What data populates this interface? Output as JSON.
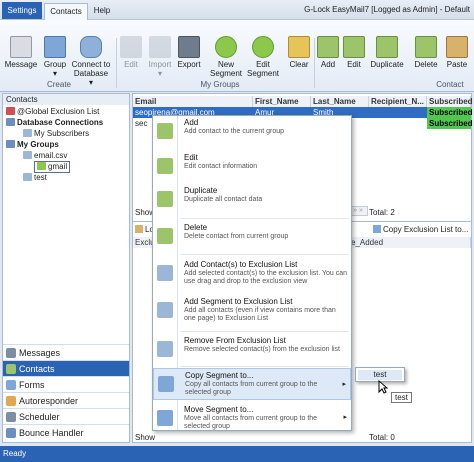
{
  "app": {
    "title": "G-Lock EasyMail7 [Logged as Admin] - Default"
  },
  "tabs": {
    "settings": "Settings",
    "contacts": "Contacts",
    "help": "Help"
  },
  "ribbon": {
    "message": "Message",
    "group": "Group",
    "connect1": "Connect to",
    "connect2": "Database",
    "edit": "Edit",
    "import": "Import",
    "export": "Export",
    "new_segment1": "New",
    "new_segment2": "Segment",
    "edit_segment1": "Edit",
    "edit_segment2": "Segment",
    "clear": "Clear",
    "add": "Add",
    "edit2": "Edit",
    "duplicate": "Duplicate",
    "delete": "Delete",
    "paste": "Paste",
    "group_create": "Create",
    "group_mygroups": "My Groups",
    "group_contact": "Contact"
  },
  "sidebar": {
    "header": "Contacts",
    "global_exclusion": "@Global Exclusion List",
    "db_connections": "Database Connections",
    "my_subscribers": "My Subscribers",
    "my_groups": "My Groups",
    "email_csv": "email.csv",
    "gmail": "gmail",
    "test": "test"
  },
  "nav": {
    "messages": "Messages",
    "contacts": "Contacts",
    "forms": "Forms",
    "autoresponder": "Autoresponder",
    "scheduler": "Scheduler",
    "bounce": "Bounce Handler"
  },
  "grid": {
    "col_email": "Email",
    "col_first": "First_Name",
    "col_last": "Last_Name",
    "col_recipient": "Recipient_N...",
    "col_subscribed": "Subscribed",
    "row1_email": "seopirena@gmail.com",
    "row1_first": "Amur",
    "row1_last": "Smith",
    "row1_sub": "Subscribed",
    "row2_email": "sec",
    "row2_sub": "Subscribed",
    "show": "Show",
    "total1": "Total: 2",
    "lock": "Lock",
    "exclu": "Exclu",
    "copy_exclusion": "Copy Exclusion List to...",
    "date_added": "e_Added",
    "show2": "Show",
    "total2": "Total: 0"
  },
  "menu": {
    "add_t": "Add",
    "add_d": "Add contact to the current group",
    "edit_t": "Edit",
    "edit_d": "Edit contact information",
    "dup_t": "Duplicate",
    "dup_d": "Duplicate all contact data",
    "del_t": "Delete",
    "del_d": "Delete contact from current group",
    "addex_t": "Add Contact(s) to Exclusion List",
    "addex_d": "Add selected contact(s) to the exclusion list. You can use drag and drop to the exclusion view",
    "addseg_t": "Add Segment to Exclusion List",
    "addseg_d": "Add all contacts (even if view contains more than one page) to Exclusion List",
    "rmex_t": "Remove From Exclusion List",
    "rmex_d": "Remove selected contact(s) from the exclusion list",
    "copy_t": "Copy Segment to...",
    "copy_d": "Copy all contacts from current group to the selected group",
    "move_t": "Move Segment to...",
    "move_d": "Move all contacts from current group to the selected group"
  },
  "submenu": {
    "test": "test"
  },
  "tooltip": "test",
  "status": "Ready"
}
